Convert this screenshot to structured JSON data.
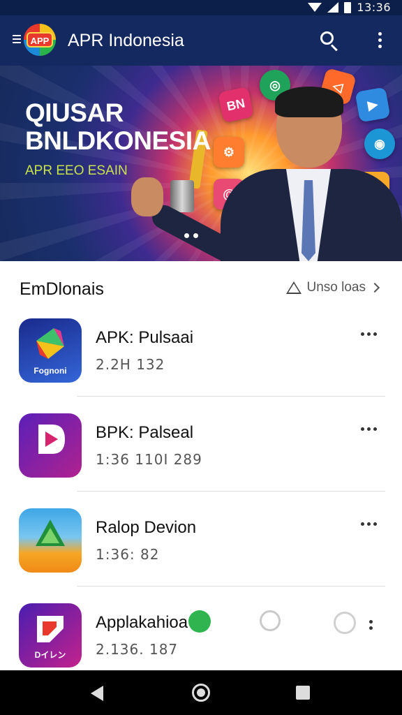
{
  "status_bar": {
    "time": "13:36"
  },
  "app_bar": {
    "logo_text": "APP",
    "title": "APR Indonesia"
  },
  "banner": {
    "headline_line1": "QIUSAR",
    "headline_line2": "BNLDKONESIA",
    "subtitle": "APR EEO ESAIN",
    "floating_icons": [
      "BN",
      "◎",
      "◁",
      "▶",
      "⚙",
      "◉",
      "@",
      "☻"
    ]
  },
  "section": {
    "title": "EmDlonais",
    "see_all_label": "Unso loas"
  },
  "apps": [
    {
      "name": "APK: Pulsaai",
      "meta": "2.2H 132",
      "icon_caption": "Fognoni"
    },
    {
      "name": "BPK: Palseal",
      "meta": "1:36 110I 289",
      "icon_caption": ""
    },
    {
      "name": "Ralop Devion",
      "meta": "1:36: 82",
      "icon_caption": ""
    },
    {
      "name": "Applakahioa",
      "meta": "2.136. 187",
      "icon_caption": "Dイレン"
    }
  ],
  "colors": {
    "app_bar": "#13295f",
    "status_bar": "#0b1f4a",
    "banner_subtitle": "#c9e34b",
    "accent_green": "#2fb44f"
  }
}
